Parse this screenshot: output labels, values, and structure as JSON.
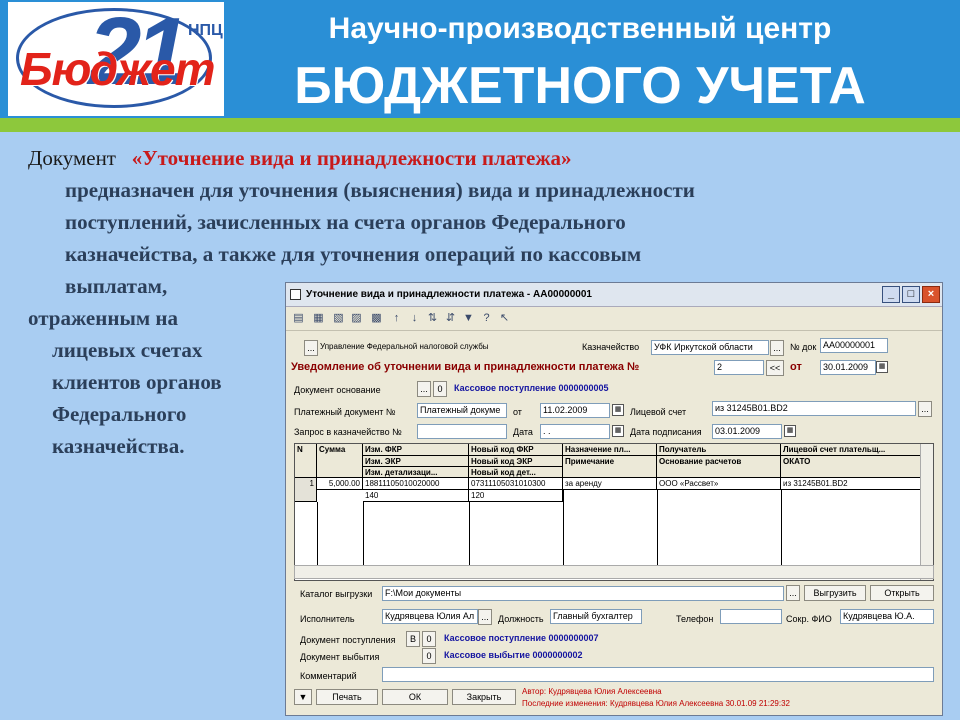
{
  "header": {
    "logo_number": "21",
    "logo_brand": "Бюджет",
    "logo_tag": "НПЦ",
    "title_line1": "Научно-производственный центр",
    "title_line2": "БЮДЖЕТНОГО УЧЕТА"
  },
  "text": {
    "word_document": "Документ",
    "quoted_name": "«Уточнение вида и принадлежности платежа»",
    "line2": "предназначен для уточнения (выяснения) вида и принадлежности",
    "line3": "поступлений, зачисленных на счета органов Федерального",
    "line4": "казначейства, а также для уточнения операций по кассовым",
    "line5": "выплатам,",
    "line6": "отраженным на",
    "line7": "лицевых счетах",
    "line8": "клиентов органов",
    "line9": "Федерального",
    "line10": "казначейства."
  },
  "window": {
    "title": "Уточнение вида и принадлежности платежа - АА00000001",
    "min": "_",
    "max": "□",
    "close": "×",
    "org_button": "...",
    "org_name": "Управление Федеральной налоговой службы",
    "treasury_label": "Казначейство",
    "treasury_value": "УФК Иркутской области",
    "ellipsis": "...",
    "docnum_label": "№ док",
    "docnum_value": "АА00000001",
    "notice_label": "Уведомление об уточнении вида и принадлежности платежа №",
    "notice_num": "2",
    "notice_arrows": "<<",
    "notice_from": "от",
    "notice_date": "30.01.2009",
    "basis_label": "Документ основание",
    "zero": "0",
    "basis_value": "Кассовое поступление 0000000005",
    "paydoc_label": "Платежный документ №",
    "paydoc_value": "Платежный докуме",
    "from_label": "от",
    "paydoc_date": "11.02.2009",
    "account_label": "Лицевой счет",
    "account_value": "из 31245В01.ВD2",
    "request_label": "Запрос в казначейство №",
    "date_label": "Дата",
    "date_value": ". .",
    "sign_label": "Дата подписания",
    "sign_value": "03.01.2009",
    "grid_headers": {
      "n": "N",
      "sum": "Сумма",
      "fkr": "Изм. ФКР",
      "ekr": "Изм. ЭКР",
      "det": "Изм. детализаци...",
      "new_fkr": "Новый код ФКР",
      "new_ekr": "Новый код ЭКР",
      "new_det": "Новый код дет...",
      "purpose": "Назначение пл...",
      "note": "Примечание",
      "payee": "Получатель",
      "basis": "Основание расчетов",
      "payer_acc": "Лицевой счет плательщ...",
      "okato": "ОКАТО"
    },
    "row": {
      "n": "1",
      "sum": "5,000.00",
      "fkr": "18811105010020000",
      "ekr": "140",
      "new_fkr": "07311105031010300",
      "new_ekr": "120",
      "purpose": "за аренду",
      "payee": "ООО «Рассвет»",
      "payer_acc": "из 31245В01.ВD2"
    },
    "catalog_label": "Каталог выгрузки",
    "catalog_value": "F:\\Мои документы",
    "unload_button": "Выгрузить",
    "open_button": "Открыть",
    "executor_label": "Исполнитель",
    "executor_value": "Кудрявцева Юлия Ал",
    "position_label": "Должность",
    "position_value": "Главный бухгалтер",
    "phone_label": "Телефон",
    "short_fio_label": "Сокр. ФИО",
    "short_fio_value": "Кудрявцева Ю.А.",
    "receipt_label": "Документ поступления",
    "receipt_b": "В",
    "receipt_value": "Кассовое поступление 0000000007",
    "payout_label": "Документ выбытия",
    "payout_value": "Кассовое выбытие 0000000002",
    "comment_label": "Комментарий",
    "print_button": "Печать",
    "ok_button": "ОК",
    "close_button": "Закрыть",
    "author": "Автор: Кудрявцева Юлия Алексеевна",
    "last_change": "Последние изменения: Кудрявцева Юлия Алексеевна 30.01.09 21:29:32"
  }
}
